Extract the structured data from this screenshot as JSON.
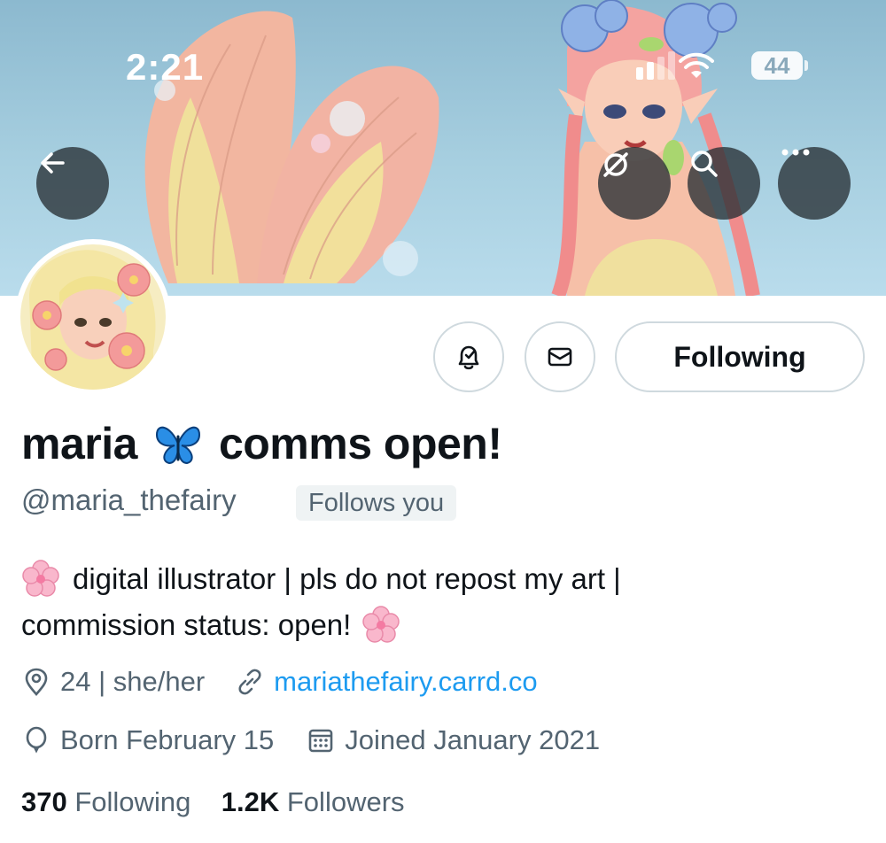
{
  "status_bar": {
    "time": "2:21",
    "battery": "44"
  },
  "profile": {
    "name_part1": "maria",
    "name_part2": "comms open!",
    "name_emoji_icon": "butterfly-icon",
    "handle": "@maria_thefairy",
    "follows_you": "Follows you",
    "bio_line1": "digital illustrator | pls do not repost my art |",
    "bio_line2": "commission status: open!",
    "bio_emoji_icon": "cherry-blossom-icon",
    "location": "24 | she/her",
    "website": "mariathefairy.carrd.co",
    "birthday": "Born February 15",
    "joined": "Joined January 2021"
  },
  "actions": {
    "follow_label": "Following",
    "notify_icon": "bell-check-icon",
    "message_icon": "envelope-icon"
  },
  "header_buttons": [
    "back-arrow-icon",
    "retweets-off-icon",
    "search-icon",
    "more-icon"
  ],
  "stats": {
    "following_count": "370",
    "following_label": "Following",
    "followers_count": "1.2K",
    "followers_label": "Followers"
  },
  "colors": {
    "link": "#1d9bf0",
    "secondary_text": "#536471",
    "text": "#0f1419",
    "badge_bg": "#eff3f4"
  }
}
